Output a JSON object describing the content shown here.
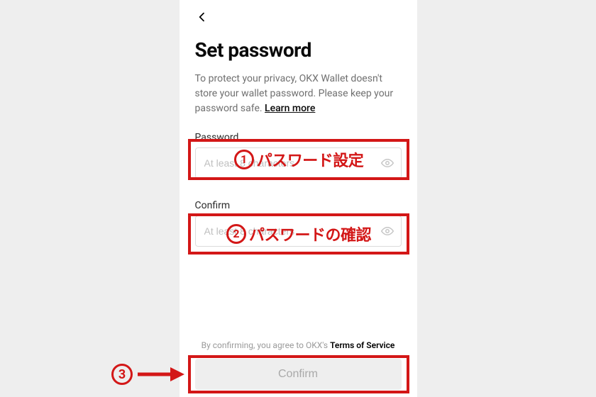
{
  "title": "Set password",
  "description": {
    "text": "To protect your privacy, OKX Wallet doesn't store your wallet password. Please keep your password safe.  ",
    "learn_more": "Learn more"
  },
  "fields": {
    "password": {
      "label": "Password",
      "placeholder": "At least 8 characters",
      "value": ""
    },
    "confirm": {
      "label": "Confirm",
      "placeholder": "At least 8 characters",
      "value": ""
    }
  },
  "terms": {
    "prefix": "By confirming, you agree to OKX's ",
    "tos": "Terms of Service"
  },
  "confirm_button": "Confirm",
  "annotations": {
    "a1": {
      "num": "1",
      "text": "パスワード設定"
    },
    "a2": {
      "num": "2",
      "text": "パスワードの確認"
    },
    "a3": {
      "num": "3"
    }
  }
}
